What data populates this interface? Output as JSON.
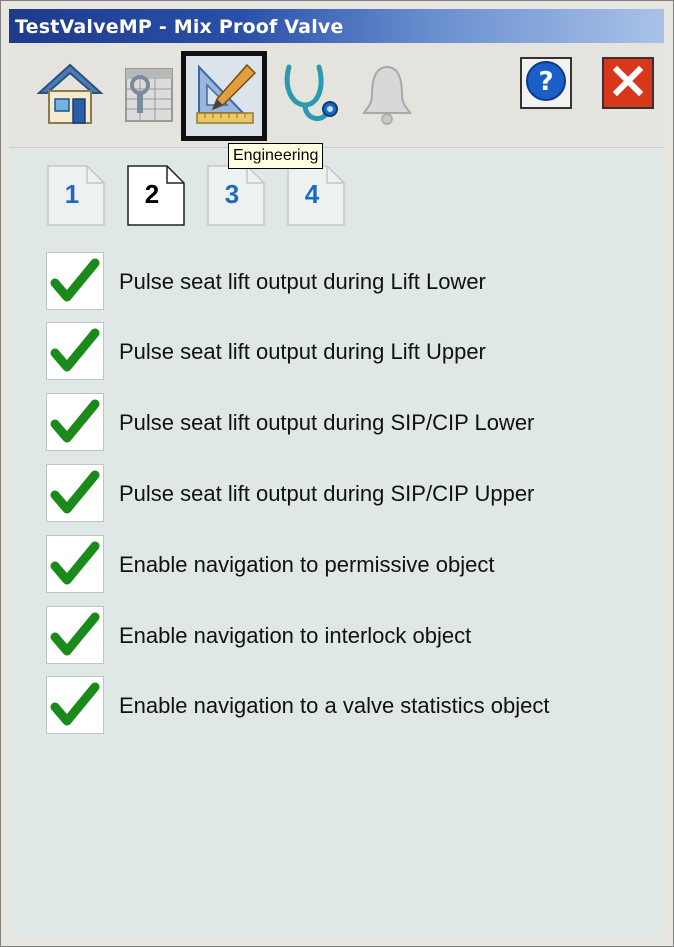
{
  "window": {
    "title": "TestValveMP - Mix Proof Valve"
  },
  "toolbar": {
    "buttons": [
      {
        "name": "home",
        "icon": "home-icon"
      },
      {
        "name": "maintenance",
        "icon": "maintenance-icon"
      },
      {
        "name": "engineering",
        "icon": "engineering-icon",
        "active": true
      },
      {
        "name": "diagnostics",
        "icon": "stethoscope-icon"
      },
      {
        "name": "alarms",
        "icon": "bell-icon"
      }
    ],
    "help_icon": "help-icon",
    "close_icon": "close-icon",
    "tooltip": "Engineering"
  },
  "pages": {
    "tabs": [
      "1",
      "2",
      "3",
      "4"
    ],
    "current": "2"
  },
  "options": [
    {
      "label": "Pulse seat lift output during Lift Lower",
      "checked": true
    },
    {
      "label": "Pulse seat lift output during Lift Upper",
      "checked": true
    },
    {
      "label": "Pulse seat lift output during SIP/CIP Lower",
      "checked": true
    },
    {
      "label": "Pulse seat lift output during SIP/CIP Upper",
      "checked": true
    },
    {
      "label": "Enable navigation to permissive object",
      "checked": true
    },
    {
      "label": "Enable navigation to interlock object",
      "checked": true
    },
    {
      "label": "Enable navigation to a valve statistics object",
      "checked": true
    }
  ],
  "colors": {
    "accent_blue": "#1e6ac0",
    "check_green": "#1a8a1a",
    "close_red": "#d9371c",
    "titlebar_blue": "#1e3b8c"
  }
}
